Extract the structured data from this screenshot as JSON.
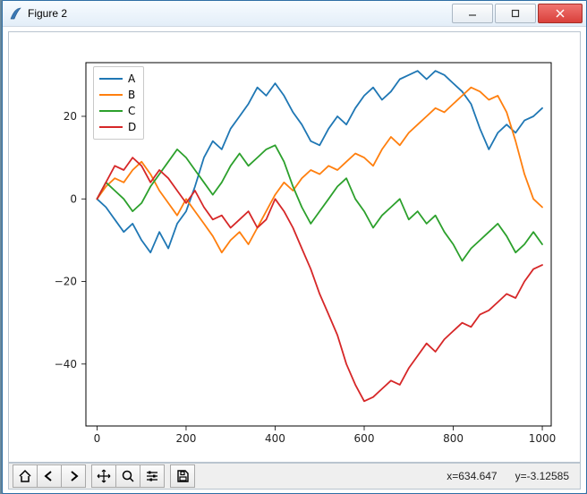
{
  "window": {
    "title": "Figure 2",
    "icon_name": "tk-feather-icon"
  },
  "toolbar": {
    "home": "Home",
    "back": "Back",
    "forward": "Forward",
    "pan": "Pan",
    "zoom": "Zoom",
    "config": "Configure subplots",
    "save": "Save"
  },
  "status": {
    "coords": "x=634.647      y=-3.12585"
  },
  "chart_data": {
    "type": "line",
    "xlabel": "",
    "ylabel": "",
    "xlim": [
      -25,
      1020
    ],
    "ylim": [
      -55,
      33
    ],
    "xticks": [
      0,
      200,
      400,
      600,
      800,
      1000
    ],
    "yticks": [
      -40,
      -20,
      0,
      20
    ],
    "legend_position": "upper left",
    "series": [
      {
        "name": "A",
        "color": "#1f77b4",
        "x": [
          0,
          20,
          40,
          60,
          80,
          100,
          120,
          140,
          160,
          180,
          200,
          220,
          240,
          260,
          280,
          300,
          320,
          340,
          360,
          380,
          400,
          420,
          440,
          460,
          480,
          500,
          520,
          540,
          560,
          580,
          600,
          620,
          640,
          660,
          680,
          700,
          720,
          740,
          760,
          780,
          800,
          820,
          840,
          860,
          880,
          900,
          920,
          940,
          960,
          980,
          1000
        ],
        "values": [
          0,
          -2,
          -5,
          -8,
          -6,
          -10,
          -13,
          -8,
          -12,
          -6,
          -3,
          3,
          10,
          14,
          12,
          17,
          20,
          23,
          27,
          25,
          28,
          25,
          21,
          18,
          14,
          13,
          17,
          20,
          18,
          22,
          25,
          27,
          24,
          26,
          29,
          30,
          31,
          29,
          31,
          30,
          28,
          26,
          23,
          17,
          12,
          16,
          18,
          16,
          19,
          20,
          22
        ]
      },
      {
        "name": "B",
        "color": "#ff7f0e",
        "x": [
          0,
          20,
          40,
          60,
          80,
          100,
          120,
          140,
          160,
          180,
          200,
          220,
          240,
          260,
          280,
          300,
          320,
          340,
          360,
          380,
          400,
          420,
          440,
          460,
          480,
          500,
          520,
          540,
          560,
          580,
          600,
          620,
          640,
          660,
          680,
          700,
          720,
          740,
          760,
          780,
          800,
          820,
          840,
          860,
          880,
          900,
          920,
          940,
          960,
          980,
          1000
        ],
        "values": [
          0,
          3,
          5,
          4,
          7,
          9,
          6,
          2,
          -1,
          -4,
          0,
          -3,
          -6,
          -9,
          -13,
          -10,
          -8,
          -11,
          -7,
          -3,
          1,
          4,
          2,
          5,
          7,
          6,
          8,
          7,
          9,
          11,
          10,
          8,
          12,
          15,
          13,
          16,
          18,
          20,
          22,
          21,
          23,
          25,
          27,
          26,
          24,
          25,
          21,
          14,
          6,
          0,
          -2
        ]
      },
      {
        "name": "C",
        "color": "#2ca02c",
        "x": [
          0,
          20,
          40,
          60,
          80,
          100,
          120,
          140,
          160,
          180,
          200,
          220,
          240,
          260,
          280,
          300,
          320,
          340,
          360,
          380,
          400,
          420,
          440,
          460,
          480,
          500,
          520,
          540,
          560,
          580,
          600,
          620,
          640,
          660,
          680,
          700,
          720,
          740,
          760,
          780,
          800,
          820,
          840,
          860,
          880,
          900,
          920,
          940,
          960,
          980,
          1000
        ],
        "values": [
          0,
          4,
          2,
          0,
          -3,
          -1,
          3,
          6,
          9,
          12,
          10,
          7,
          4,
          1,
          4,
          8,
          11,
          8,
          10,
          12,
          13,
          9,
          3,
          -2,
          -6,
          -3,
          0,
          3,
          5,
          0,
          -3,
          -7,
          -4,
          -2,
          0,
          -5,
          -3,
          -6,
          -4,
          -8,
          -11,
          -15,
          -12,
          -10,
          -8,
          -6,
          -9,
          -13,
          -11,
          -8,
          -11
        ]
      },
      {
        "name": "D",
        "color": "#d62728",
        "x": [
          0,
          20,
          40,
          60,
          80,
          100,
          120,
          140,
          160,
          180,
          200,
          220,
          240,
          260,
          280,
          300,
          320,
          340,
          360,
          380,
          400,
          420,
          440,
          460,
          480,
          500,
          520,
          540,
          560,
          580,
          600,
          620,
          640,
          660,
          680,
          700,
          720,
          740,
          760,
          780,
          800,
          820,
          840,
          860,
          880,
          900,
          920,
          940,
          960,
          980,
          1000
        ],
        "values": [
          0,
          4,
          8,
          7,
          10,
          8,
          4,
          7,
          5,
          2,
          -1,
          2,
          -2,
          -5,
          -4,
          -7,
          -5,
          -3,
          -7,
          -5,
          0,
          -3,
          -7,
          -12,
          -17,
          -23,
          -28,
          -33,
          -40,
          -45,
          -49,
          -48,
          -46,
          -44,
          -45,
          -41,
          -38,
          -35,
          -37,
          -34,
          -32,
          -30,
          -31,
          -28,
          -27,
          -25,
          -23,
          -24,
          -20,
          -17,
          -16
        ]
      }
    ]
  }
}
